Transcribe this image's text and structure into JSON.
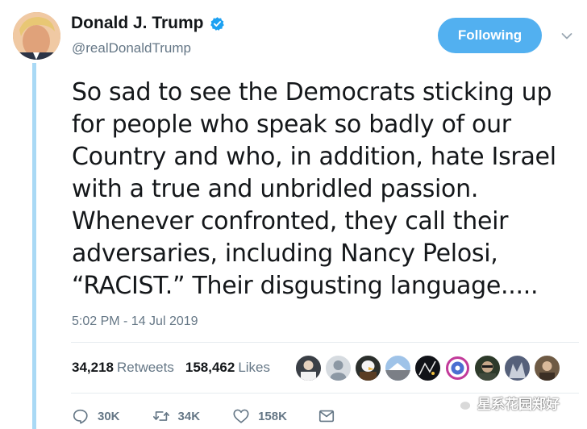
{
  "author": {
    "display_name": "Donald J. Trump",
    "handle": "@realDonaldTrump",
    "verified": true
  },
  "follow_button": {
    "label": "Following"
  },
  "tweet": {
    "lines": [
      "So sad to see the Democrats sticking up",
      "for people who speak so badly of our",
      "Country and who, in addition, hate Israel",
      "with a true and unbridled passion.",
      "Whenever confronted, they call their",
      "adversaries, including Nancy Pelosi,",
      "“RACIST.” Their disgusting language....."
    ],
    "timestamp": "5:02 PM - 14 Jul 2019"
  },
  "stats": {
    "retweets_count": "34,218",
    "retweets_label": "Retweets",
    "likes_count": "158,462",
    "likes_label": "Likes"
  },
  "actions": {
    "reply_count": "30K",
    "retweet_count": "34K",
    "like_count": "158K"
  },
  "watermark": {
    "text": "星系花园郑好"
  },
  "icons": {
    "verified": "verified-badge-icon",
    "caret": "chevron-down-icon",
    "reply": "reply-icon",
    "retweet": "retweet-icon",
    "like": "heart-icon",
    "dm": "envelope-icon",
    "watermark": "wechat-icon"
  },
  "colors": {
    "accent": "#1da1f2",
    "follow_button": "#52b0f0",
    "thread_line": "#a9d9f5",
    "muted_text": "#657786"
  }
}
